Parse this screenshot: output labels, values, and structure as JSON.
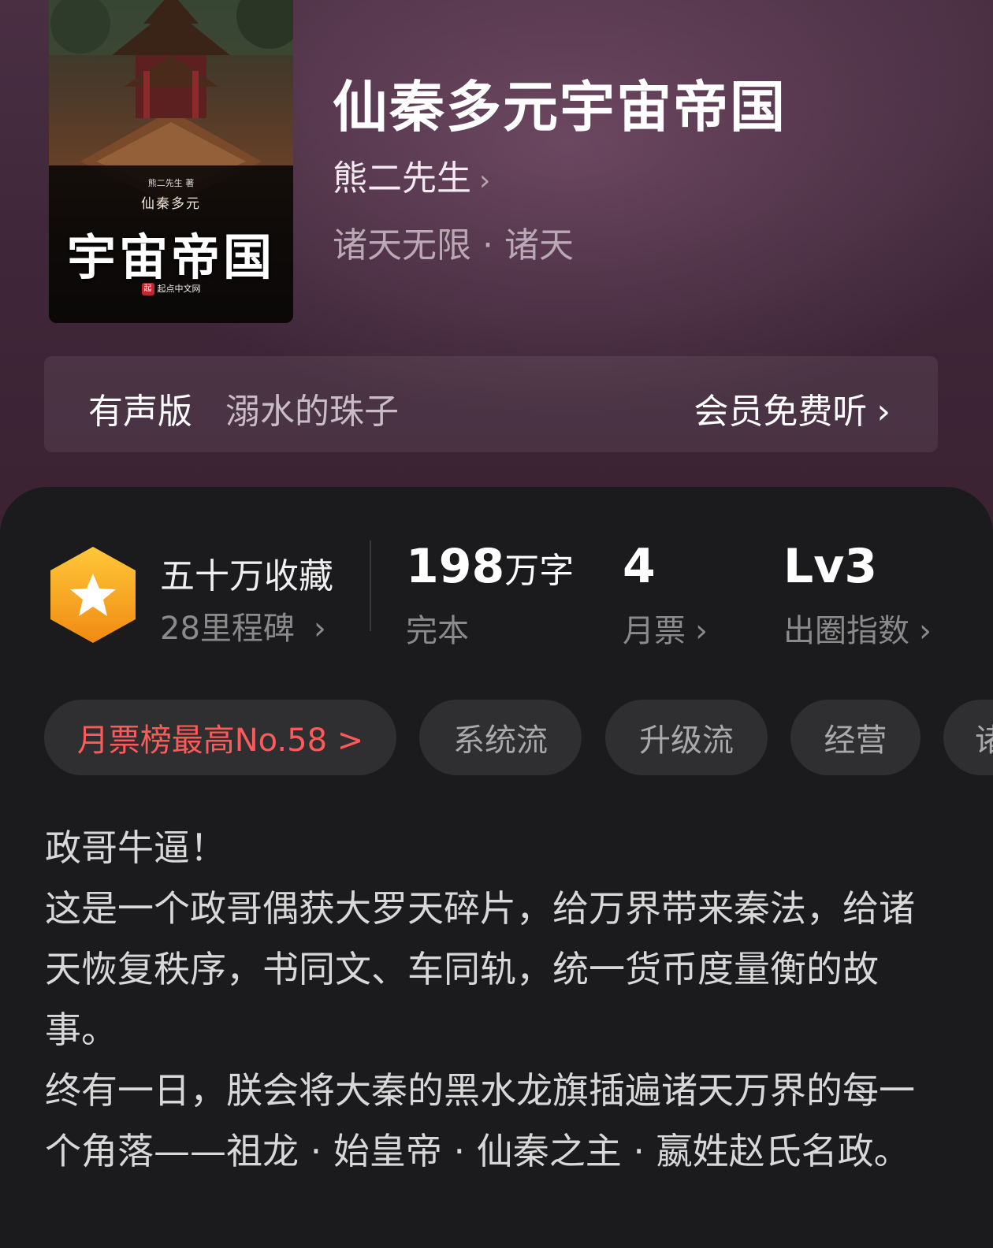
{
  "cover": {
    "author_line": "熊二先生 著",
    "series_line": "仙秦多元",
    "title_line": "宇宙帝国",
    "publisher": "起点中文网",
    "publisher_logo": "起"
  },
  "book": {
    "title": "仙秦多元宇宙帝国",
    "author": "熊二先生",
    "category": "诸天无限 · 诸天"
  },
  "audio": {
    "label": "有声版",
    "narrator": "溺水的珠子",
    "cta": "会员免费听"
  },
  "stats": {
    "collect_primary": "五十万收藏",
    "collect_sub": "28里程碑",
    "words_value": "198",
    "words_unit": "万字",
    "words_label": "完本",
    "tickets_value": "4",
    "tickets_label": "月票",
    "index_value": "Lv3",
    "index_label": "出圈指数"
  },
  "tags": [
    {
      "label": "月票榜最高No.58 >"
    },
    {
      "label": "系统流"
    },
    {
      "label": "升级流"
    },
    {
      "label": "经营"
    },
    {
      "label": "诸"
    }
  ],
  "description": "政哥牛逼！\n这是一个政哥偶获大罗天碎片，给万界带来秦法，给诸天恢复秩序，书同文、车同轨，统一货币度量衡的故事。\n终有一日，朕会将大秦的黑水龙旗插遍诸天万界的每一个角落——祖龙 · 始皇帝 · 仙秦之主 · 嬴姓赵氏名政。",
  "colors": {
    "accent_red": "#ff5a5a",
    "badge_gold": "#f5a623",
    "hero_bg": "#3f2739",
    "sheet_bg": "#1b1a1c"
  },
  "icons": [
    "chevron-right-icon",
    "star-badge-icon"
  ]
}
